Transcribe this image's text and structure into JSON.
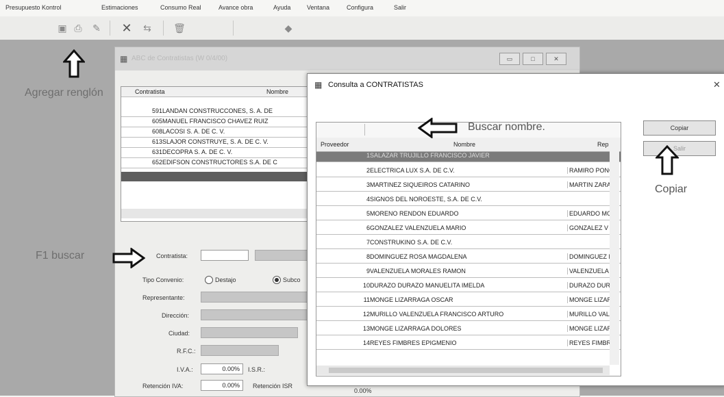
{
  "menu": [
    "Presupuesto Kontrol",
    "Estimaciones",
    "Consumo Real",
    "Avance obra",
    "Ayuda",
    "Ventana",
    "Configura",
    "Salir"
  ],
  "toolbar_icons": [
    "save-icon",
    "print-icon",
    "pin-icon",
    "close-icon",
    "minus-icon",
    "trash-icon",
    "diamond-icon"
  ],
  "annotations": {
    "agregar": "Agregar renglón",
    "f1_buscar": "F1 buscar",
    "buscar_nombre": "Buscar nombre.",
    "copiar": "Copiar"
  },
  "abc_window": {
    "title": "ABC de Contratistas (W 0/4/00)",
    "columns": [
      "Contratista",
      "Nombre"
    ],
    "rows": [
      {
        "id": "591",
        "name": "LANDAN CONSTRUCCONES, S. A. DE"
      },
      {
        "id": "605",
        "name": "MANUEL FRANCISCO CHAVEZ RUIZ"
      },
      {
        "id": "608",
        "name": "LACOSI S. A. DE C. V."
      },
      {
        "id": "613",
        "name": "SLAJOR CONSTRUYE, S. A. DE C. V."
      },
      {
        "id": "631",
        "name": "DECOPRA S. A. DE C. V."
      },
      {
        "id": "652",
        "name": "EDIFSON CONSTRUCTORES S.A. DE C"
      }
    ],
    "form": {
      "contratista_label": "Contratista:",
      "tipo_convenio_label": "Tipo Convenio:",
      "destajo_label": "Destajo",
      "subcontrato_label": "Subco",
      "representante_label": "Representante:",
      "direccion_label": "Dirección:",
      "ciudad_label": "Ciudad:",
      "rfc_label": "R.F.C.:",
      "iva_label": "I.V.A.:",
      "iva_value": "0.00%",
      "isr_label": "I.S.R.:",
      "ret_iva_label": "Retención IVA:",
      "ret_iva_value": "0.00%",
      "ret_isr_label": "Retención ISR",
      "ret_isr_value": "0.00%"
    }
  },
  "consulta_dialog": {
    "title": "Consulta a CONTRATISTAS",
    "columns": [
      "Proveedor",
      "Nombre",
      "Rep"
    ],
    "rows": [
      {
        "id": "1",
        "name": "SALAZAR TRUJILLO FRANCISCO JAVIER",
        "rep": ""
      },
      {
        "id": "2",
        "name": "ELECTRICA LUX S.A. DE C.V.",
        "rep": "RAMIRO PONC"
      },
      {
        "id": "3",
        "name": "MARTINEZ SIQUEIROS CATARINO",
        "rep": "MARTIN ZARA"
      },
      {
        "id": "4",
        "name": "SIGNOS DEL NOROESTE, S.A. DE C.V.",
        "rep": ""
      },
      {
        "id": "5",
        "name": "MORENO RENDON EDUARDO",
        "rep": "EDUARDO MO"
      },
      {
        "id": "6",
        "name": "GONZALEZ VALENZUELA MARIO",
        "rep": "GONZALEZ V"
      },
      {
        "id": "7",
        "name": "CONSTRUKINO S.A. DE C.V.",
        "rep": ""
      },
      {
        "id": "8",
        "name": "DOMINGUEZ ROSA MAGDALENA",
        "rep": "DOMINGUEZ F"
      },
      {
        "id": "9",
        "name": "VALENZUELA MORALES RAMON",
        "rep": "VALENZUELA"
      },
      {
        "id": "10",
        "name": "DURAZO DURAZO MANUELITA IMELDA",
        "rep": "DURAZO DUR"
      },
      {
        "id": "11",
        "name": "MONGE LIZARRAGA OSCAR",
        "rep": "MONGE LIZAR"
      },
      {
        "id": "12",
        "name": "MURILLO VALENZUELA FRANCISCO ARTURO",
        "rep": "MURILLO VAL"
      },
      {
        "id": "13",
        "name": "MONGE LIZARRAGA DOLORES",
        "rep": "MONGE LIZAR"
      },
      {
        "id": "14",
        "name": "REYES FIMBRES EPIGMENIO",
        "rep": "REYES FIMBR"
      }
    ],
    "copy_button": "Copiar",
    "exit_button": "Salir",
    "selected_index": 0
  }
}
